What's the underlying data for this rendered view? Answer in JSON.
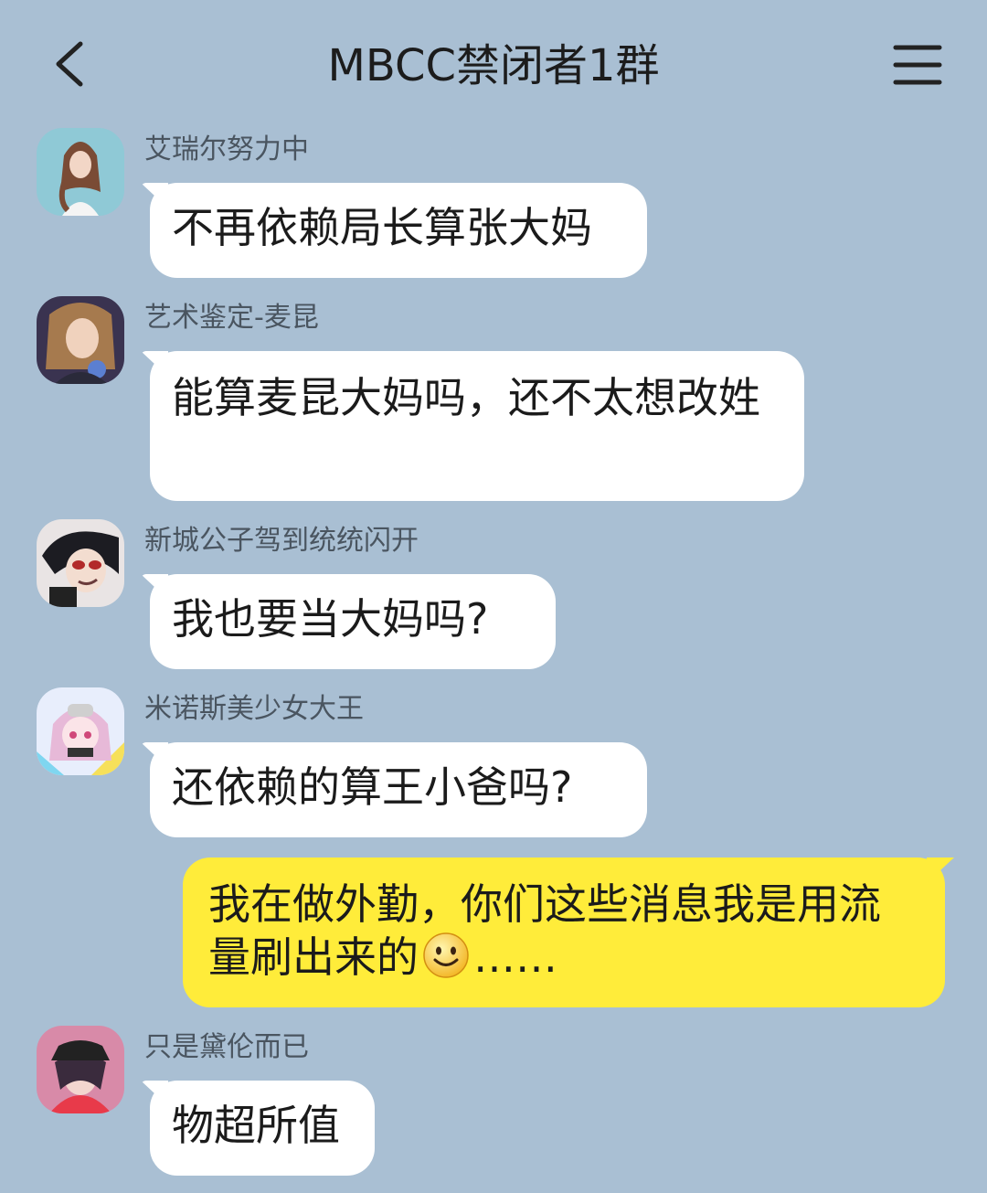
{
  "header": {
    "title": "MBCC禁闭者1群"
  },
  "messages": [
    {
      "sender": "艾瑞尔努力中",
      "text": "不再依赖局长算张大妈"
    },
    {
      "sender": "艺术鉴定-麦昆",
      "text": "能算麦昆大妈吗，还不太想改姓"
    },
    {
      "sender": "新城公子驾到统统闪开",
      "text": "我也要当大妈吗?"
    },
    {
      "sender": "米诺斯美少女大王",
      "text": "还依赖的算王小爸吗?"
    },
    {
      "sender": "",
      "text_before_emoji": "我在做外勤，你们这些消息我是用流量刷出来的",
      "emoji": "smiling-face-emoji",
      "text_after_emoji": "……"
    },
    {
      "sender": "只是黛伦而已",
      "text": "物超所值"
    }
  ],
  "colors": {
    "background": "#a9bfd3",
    "incoming_bubble": "#ffffff",
    "outgoing_bubble": "#ffec3a"
  },
  "icons": {
    "back": "chevron-left-icon",
    "menu": "hamburger-menu-icon"
  }
}
